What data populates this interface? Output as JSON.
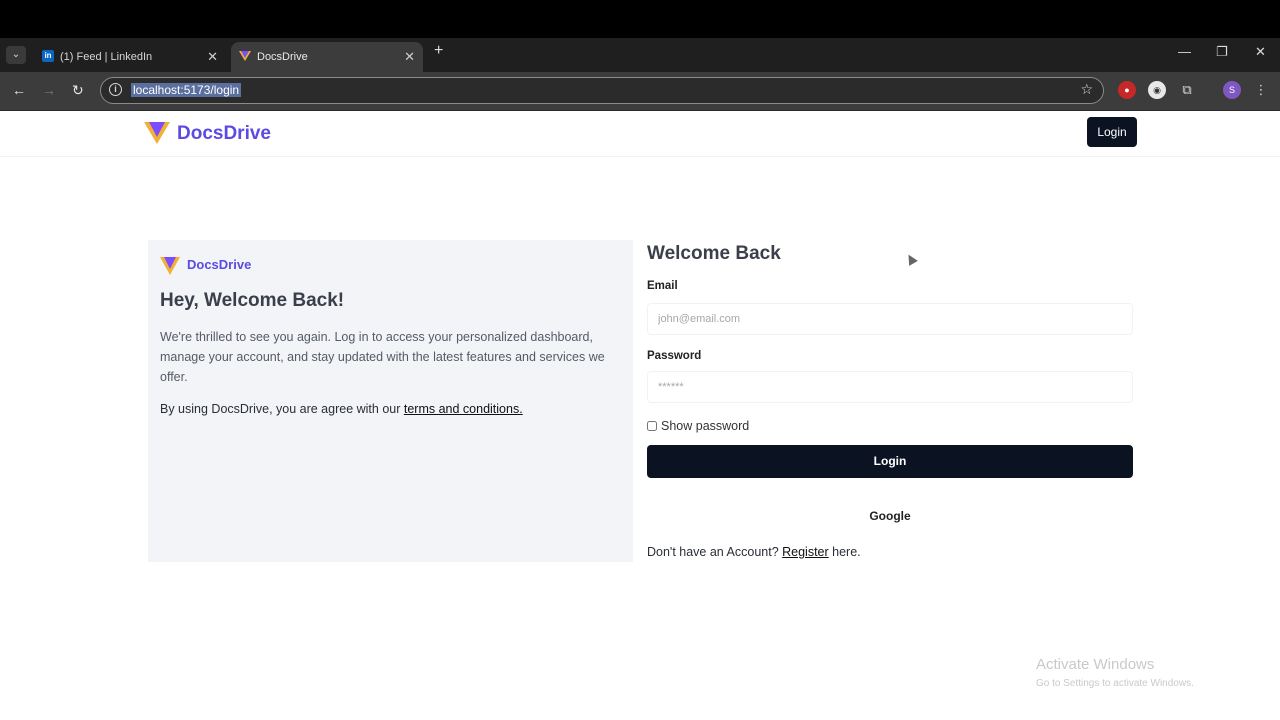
{
  "browser": {
    "tabs": [
      {
        "title": "(1) Feed | LinkedIn",
        "icon": "linkedin-icon",
        "active": false
      },
      {
        "title": "DocsDrive",
        "icon": "docsdrive-logo-icon",
        "active": true
      }
    ],
    "url": "localhost:5173/login"
  },
  "header": {
    "brand": "DocsDrive",
    "login_button": "Login"
  },
  "left_card": {
    "brand": "DocsDrive",
    "heading": "Hey, Welcome Back!",
    "paragraph": "We're thrilled to see you again. Log in to access your personalized dashboard, manage your account, and stay updated with the latest features and services we offer.",
    "terms_prefix": "By using DocsDrive, you are agree with our ",
    "terms_link": "terms and conditions."
  },
  "login_form": {
    "heading": "Welcome Back",
    "email_label": "Email",
    "email_placeholder": "john@email.com",
    "password_label": "Password",
    "password_placeholder": "******",
    "show_password_label": "Show password",
    "submit_label": "Login",
    "google_label": "Google",
    "register_prefix": "Don't have an Account? ",
    "register_link": "Register",
    "register_suffix": " here."
  },
  "watermark": {
    "title": "Activate Windows",
    "subtitle": "Go to Settings to activate Windows."
  },
  "colors": {
    "brand": "#5b4be0",
    "primary_button": "#0b1222",
    "card_background": "#f2f4f8"
  }
}
